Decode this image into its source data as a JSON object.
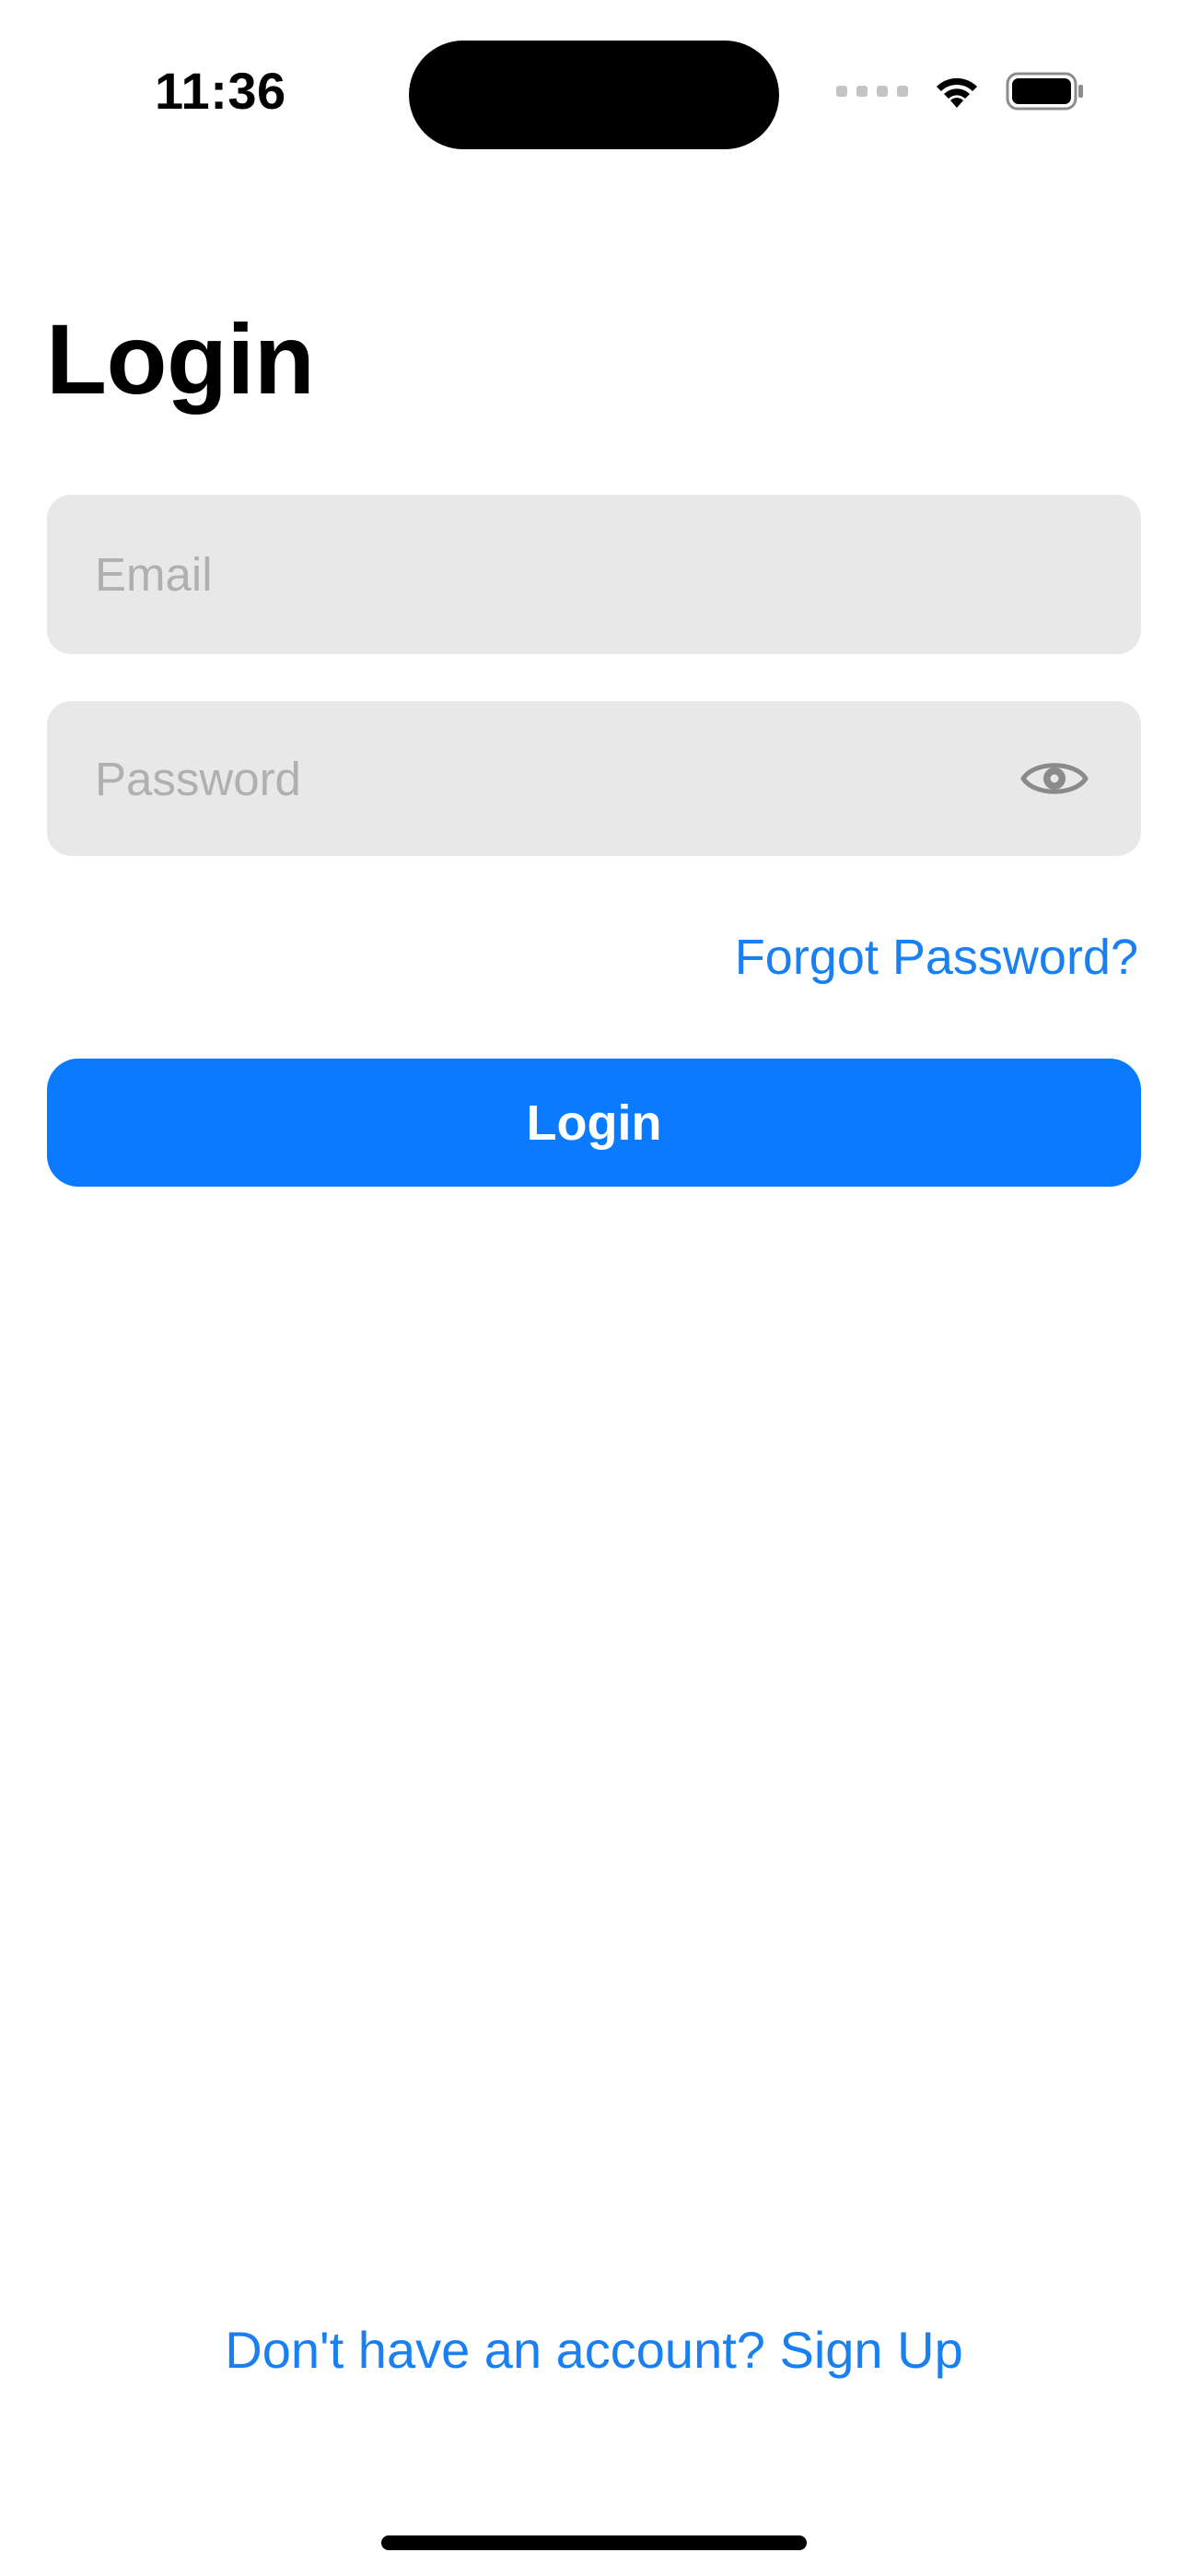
{
  "status_bar": {
    "time": "11:36",
    "icons": [
      "cellular-signal-icon",
      "wifi-icon",
      "battery-icon"
    ]
  },
  "login_screen": {
    "title": "Login",
    "email_field": {
      "placeholder": "Email",
      "value": ""
    },
    "password_field": {
      "placeholder": "Password",
      "value": "",
      "toggle_icon": "eye-icon"
    },
    "forgot_password_label": "Forgot Password?",
    "login_button_label": "Login",
    "signup_prompt": "Don't have an account? Sign Up"
  },
  "colors": {
    "accent": "#0a7bff",
    "link": "#1a80f2",
    "field_background": "#e8e8e8",
    "placeholder": "#b0b0b0",
    "background": "#ffffff"
  }
}
